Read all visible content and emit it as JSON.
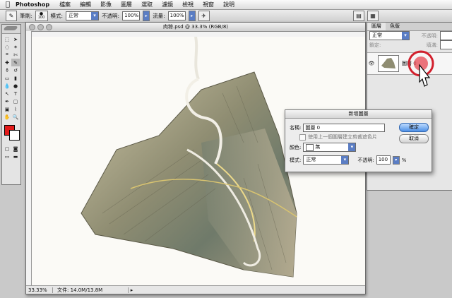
{
  "menubar": {
    "app": "Photoshop",
    "items": [
      "檔案",
      "編輯",
      "影像",
      "圖層",
      "選取",
      "濾鏡",
      "檢視",
      "視窗",
      "說明"
    ]
  },
  "options": {
    "brush_label": "筆刷:",
    "brush_size": "100",
    "mode_label": "模式:",
    "mode_value": "正常",
    "opacity_label": "不透明:",
    "opacity_value": "100%",
    "flow_label": "流量:",
    "flow_value": "100%"
  },
  "document": {
    "title": "肉粽.psd @ 33.3% (RGB/8)",
    "zoom": "33.33%",
    "file_info": "文件: 14.0M/13.8M"
  },
  "colors": {
    "foreground": "#e21a1a",
    "background": "#ffffff"
  },
  "layers_panel": {
    "tabs": [
      "圖層",
      "色版"
    ],
    "blend_mode": "正常",
    "opacity_label": "不透明:",
    "lock_label": "鎖定:",
    "fill_label": "填滿:",
    "layer_name": "圖層 0"
  },
  "dialog": {
    "title": "新增圖層",
    "name_label": "名稱:",
    "name_value": "圖層 0",
    "checkbox_label": "使用上一個圖層建立剪裁遮色片",
    "color_label": "顏色:",
    "color_value": "無",
    "mode_label": "模式:",
    "mode_value": "正常",
    "opacity_label": "不透明:",
    "opacity_value": "100",
    "percent": "%",
    "ok": "確定",
    "cancel": "取消"
  }
}
